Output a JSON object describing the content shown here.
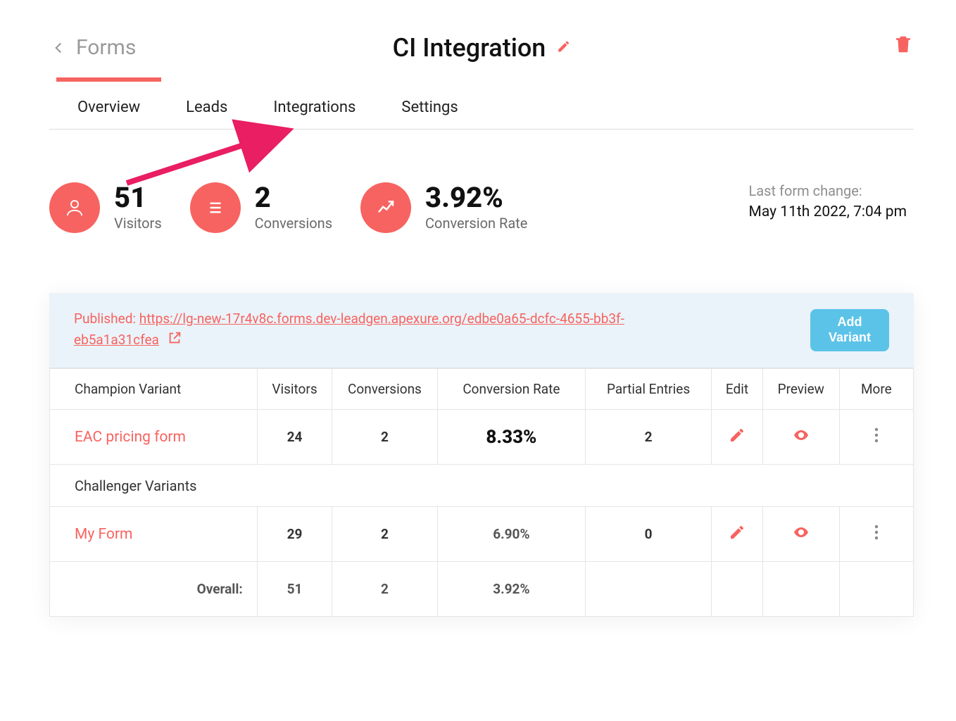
{
  "header": {
    "back_label": "Forms",
    "title": "CI Integration"
  },
  "tabs": [
    {
      "label": "Overview",
      "active": true
    },
    {
      "label": "Leads",
      "active": false
    },
    {
      "label": "Integrations",
      "active": false
    },
    {
      "label": "Settings",
      "active": false
    }
  ],
  "stats": {
    "visitors": {
      "value": "51",
      "label": "Visitors"
    },
    "conversions": {
      "value": "2",
      "label": "Conversions"
    },
    "rate": {
      "value": "3.92%",
      "label": "Conversion Rate"
    }
  },
  "last_change": {
    "label": "Last form change:",
    "value": "May 11th 2022, 7:04 pm"
  },
  "published": {
    "prefix": "Published: ",
    "url": "https://lg-new-17r4v8c.forms.dev-leadgen.apexure.org/edbe0a65-dcfc-4655-bb3f-eb5a1a31cfea"
  },
  "add_variant_button": "Add Variant",
  "table": {
    "headers": {
      "champion": "Champion Variant",
      "visitors": "Visitors",
      "conversions": "Conversions",
      "rate": "Conversion Rate",
      "partial": "Partial Entries",
      "edit": "Edit",
      "preview": "Preview",
      "more": "More"
    },
    "champion": {
      "name": "EAC pricing form",
      "visitors": "24",
      "conversions": "2",
      "rate": "8.33%",
      "partial": "2"
    },
    "challenger_heading": "Challenger Variants",
    "challengers": [
      {
        "name": "My Form",
        "visitors": "29",
        "conversions": "2",
        "rate": "6.90%",
        "partial": "0"
      }
    ],
    "overall": {
      "label": "Overall:",
      "visitors": "51",
      "conversions": "2",
      "rate": "3.92%"
    }
  },
  "colors": {
    "accent": "#f76360",
    "blue": "#5cc3e8",
    "arrow": "#e91e63"
  }
}
